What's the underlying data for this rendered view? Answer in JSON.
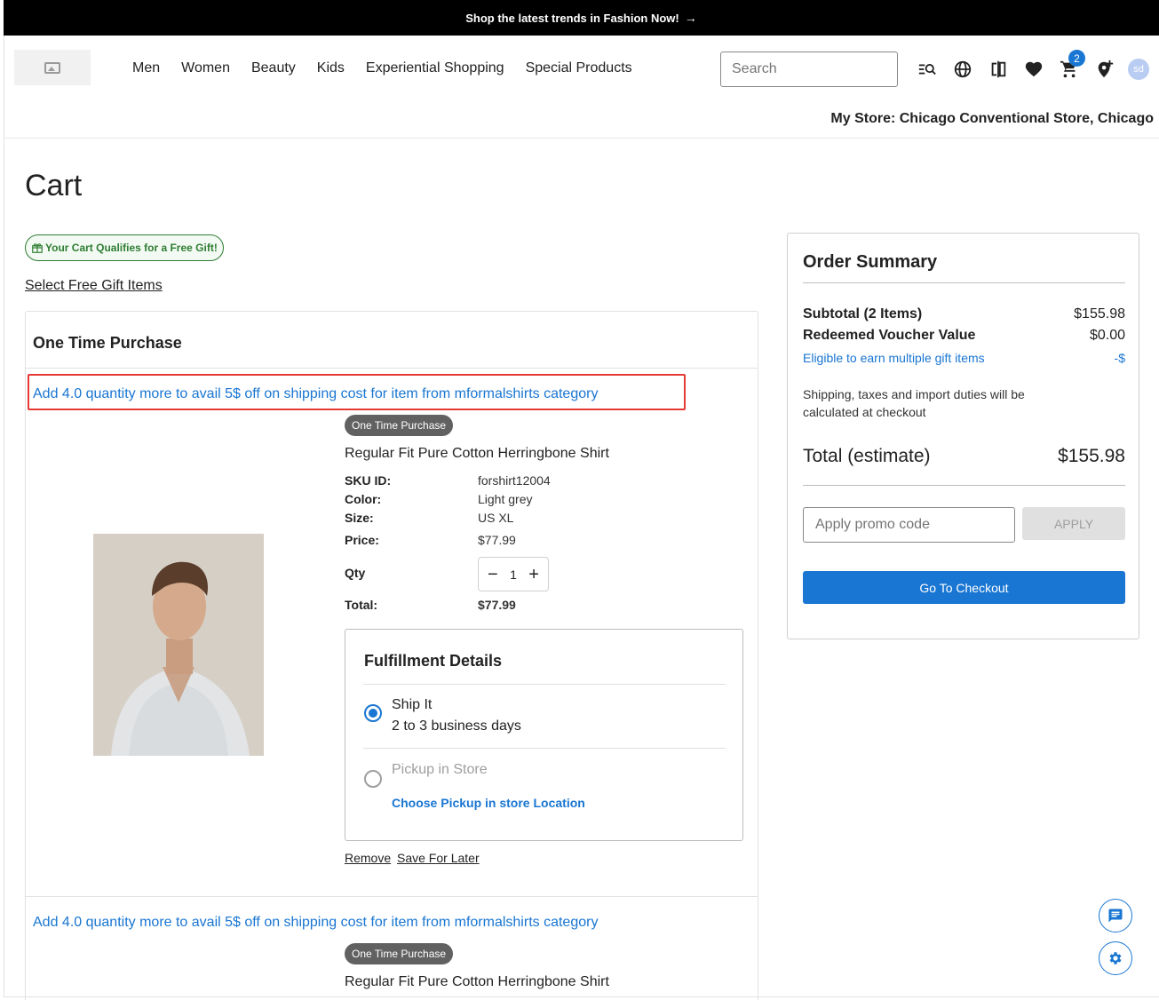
{
  "topbar": {
    "text": "Shop the latest trends in Fashion Now!",
    "arrow": "→"
  },
  "nav": [
    "Men",
    "Women",
    "Beauty",
    "Kids",
    "Experiential Shopping",
    "Special Products"
  ],
  "search": {
    "placeholder": "Search"
  },
  "header": {
    "cart_count": "2",
    "avatar": "sd",
    "store": "My Store: Chicago Conventional Store, Chicago"
  },
  "page": {
    "title": "Cart",
    "gift_chip": "Your Cart Qualifies for a Free Gift!",
    "free_gift_link": "Select Free Gift Items"
  },
  "cart": {
    "section_title": "One Time Purchase",
    "items": [
      {
        "promo": "Add 4.0 quantity more to avail 5$ off on shipping cost for item from mformalshirts category",
        "pill": "One Time Purchase",
        "name": "Regular Fit Pure Cotton Herringbone Shirt",
        "sku_label": "SKU ID:",
        "sku": "forshirt12004",
        "color_label": "Color:",
        "color": "Light grey",
        "size_label": "Size:",
        "size": "US XL",
        "price_label": "Price:",
        "price": "$77.99",
        "qty_label": "Qty",
        "qty": "1",
        "total_label": "Total:",
        "total": "$77.99",
        "fulfillment": {
          "title": "Fulfillment Details",
          "ship_label": "Ship It",
          "ship_sub": "2 to 3 business days",
          "pickup_label": "Pickup in Store",
          "choose_link": "Choose Pickup in store Location"
        },
        "remove": "Remove",
        "save_later": "Save For Later"
      },
      {
        "promo": "Add 4.0 quantity more to avail 5$ off on shipping cost for item from mformalshirts category",
        "pill": "One Time Purchase",
        "name": "Regular Fit Pure Cotton Herringbone Shirt"
      }
    ]
  },
  "summary": {
    "title": "Order Summary",
    "subtotal_label": "Subtotal (2 Items)",
    "subtotal": "$155.98",
    "voucher_label": "Redeemed Voucher Value",
    "voucher": "$0.00",
    "gift_label": "Eligible to earn multiple gift items",
    "gift_value": "-$",
    "note": "Shipping, taxes and import duties will be calculated at checkout",
    "total_label": "Total (estimate)",
    "total": "$155.98",
    "promo_placeholder": "Apply promo code",
    "apply": "APPLY",
    "checkout": "Go To Checkout"
  },
  "colors": {
    "accent": "#1976d2",
    "gift_green": "#2e7d32",
    "highlight_red": "#e53935"
  }
}
